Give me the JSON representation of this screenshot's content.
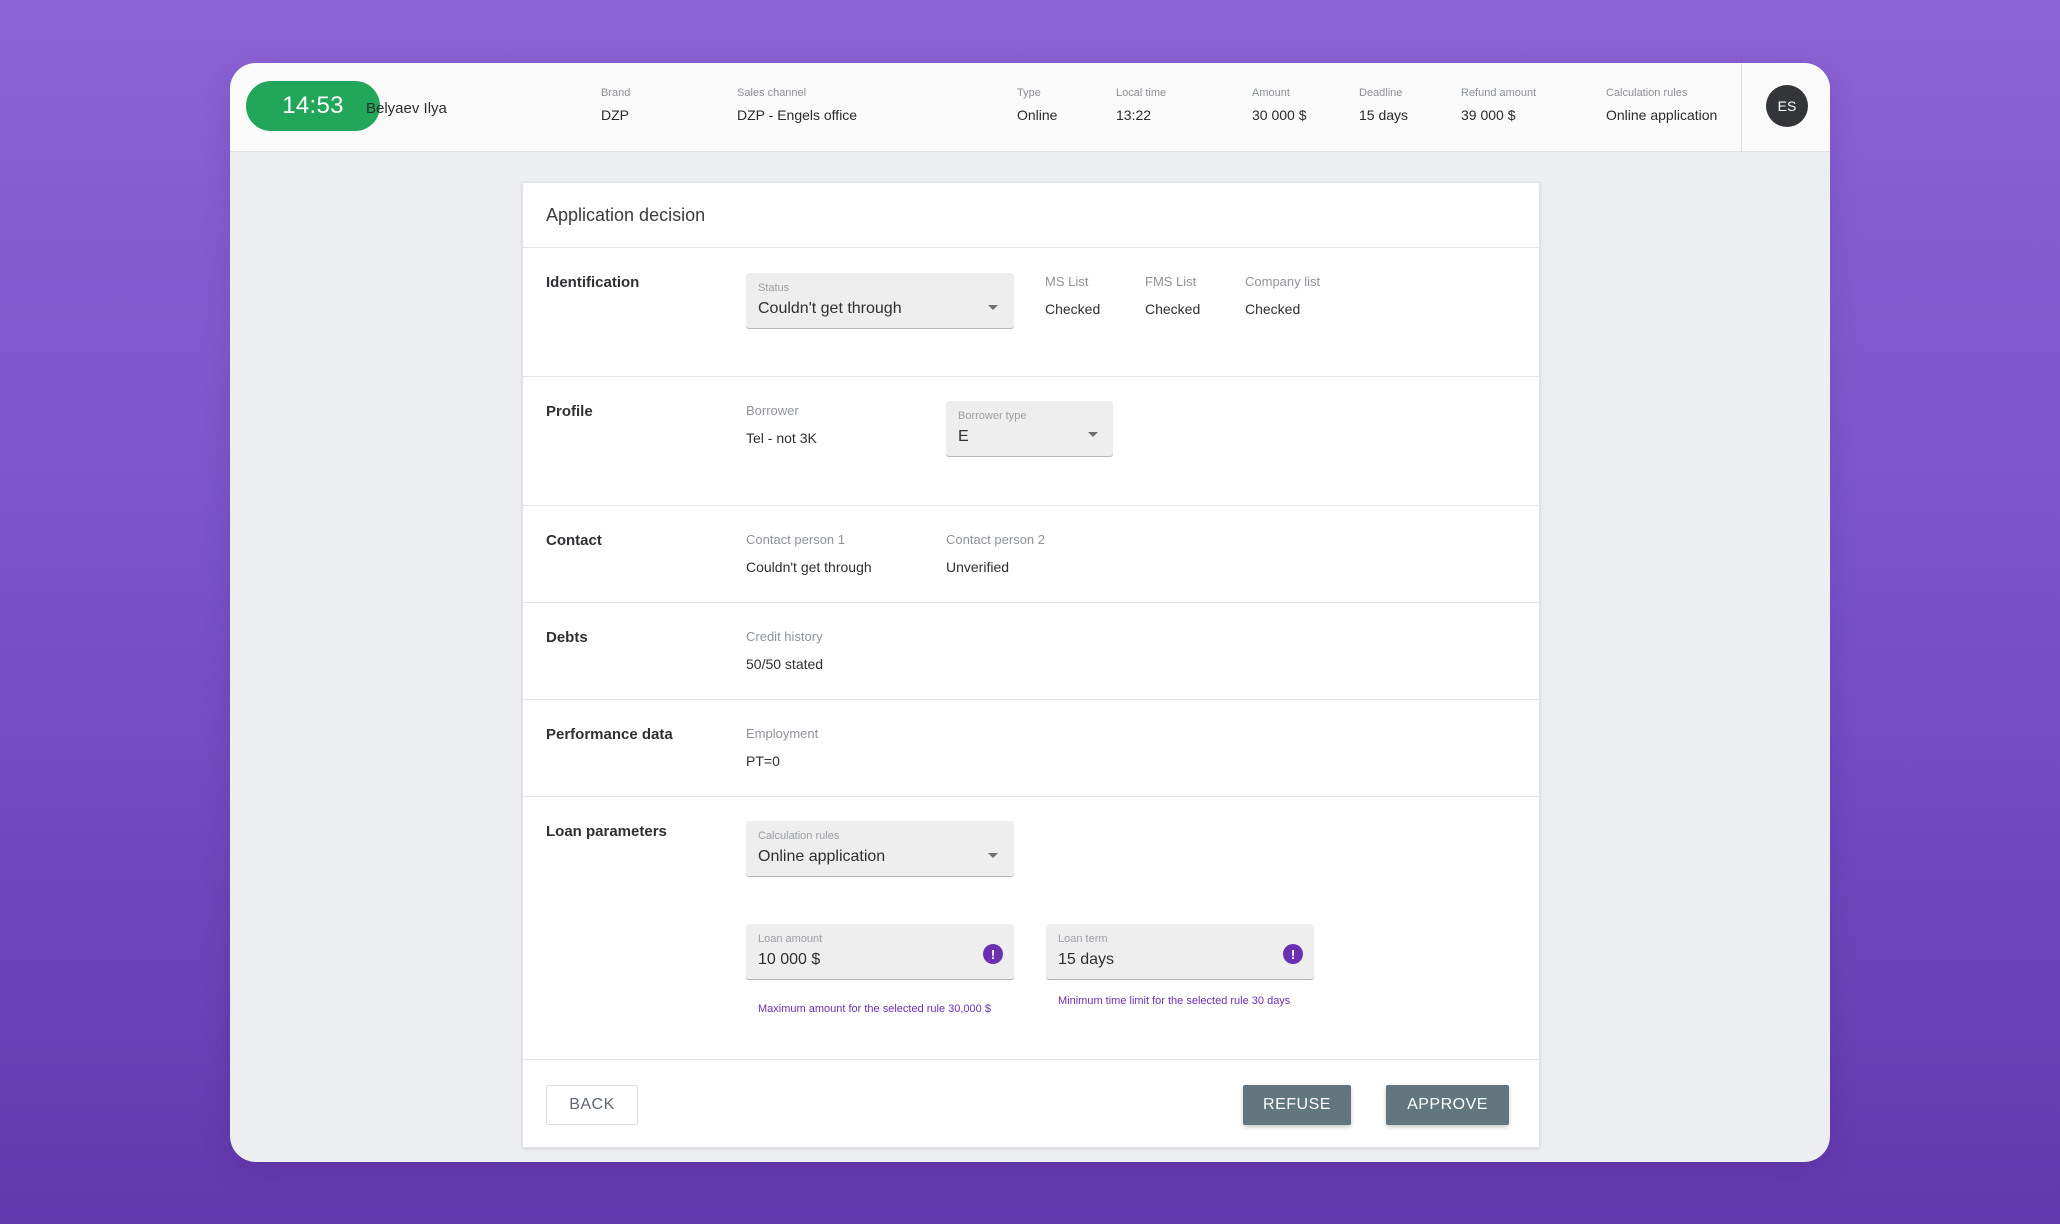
{
  "header": {
    "timer": "14:53",
    "operator_name": "Belyaev Ilya",
    "avatar_initials": "ES",
    "fields": [
      {
        "label": "Brand",
        "value": "DZP"
      },
      {
        "label": "Sales channel",
        "value": "DZP - Engels office"
      },
      {
        "label": "Type",
        "value": "Online"
      },
      {
        "label": "Local time",
        "value": "13:22"
      },
      {
        "label": "Amount",
        "value": "30 000 $"
      },
      {
        "label": "Deadline",
        "value": "15 days"
      },
      {
        "label": "Refund amount",
        "value": "39 000 $"
      },
      {
        "label": "Calculation rules",
        "value": "Online application"
      }
    ]
  },
  "card": {
    "title": "Application decision",
    "identification": {
      "title": "Identification",
      "status": {
        "label": "Status",
        "value": "Couldn't get through"
      },
      "checks": [
        {
          "label": "MS List",
          "value": "Checked"
        },
        {
          "label": "FMS List",
          "value": "Checked"
        },
        {
          "label": "Company list",
          "value": "Checked"
        }
      ]
    },
    "profile": {
      "title": "Profile",
      "borrower": {
        "label": "Borrower",
        "value": "Tel - not 3K"
      },
      "borrower_type": {
        "label": "Borrower type",
        "value": "E"
      }
    },
    "contact": {
      "title": "Contact",
      "person1": {
        "label": "Contact person 1",
        "value": "Couldn't get through"
      },
      "person2": {
        "label": "Contact person 2",
        "value": "Unverified"
      }
    },
    "debts": {
      "title": "Debts",
      "credit_history": {
        "label": "Credit history",
        "value": "50/50 stated"
      }
    },
    "performance": {
      "title": "Performance data",
      "employment": {
        "label": "Employment",
        "value": "PT=0"
      }
    },
    "loan": {
      "title": "Loan parameters",
      "calculation_rules": {
        "label": "Calculation rules",
        "value": "Online application"
      },
      "amount": {
        "label": "Loan amount",
        "value": "10 000 $",
        "hint": "Maximum amount for the selected rule 30,000 $"
      },
      "term": {
        "label": "Loan term",
        "value": "15 days",
        "hint": "Minimum time limit for the selected rule 30 days"
      }
    }
  },
  "actions": {
    "back": "BACK",
    "refuse": "REFUSE",
    "approve": "APPROVE"
  },
  "colors": {
    "timer_green": "#21a65a",
    "warning_purple": "#6a30b1",
    "primary_button": "#62767f"
  },
  "icons": {
    "dropdown": "chevron-down-icon",
    "warning": "warning-icon"
  }
}
